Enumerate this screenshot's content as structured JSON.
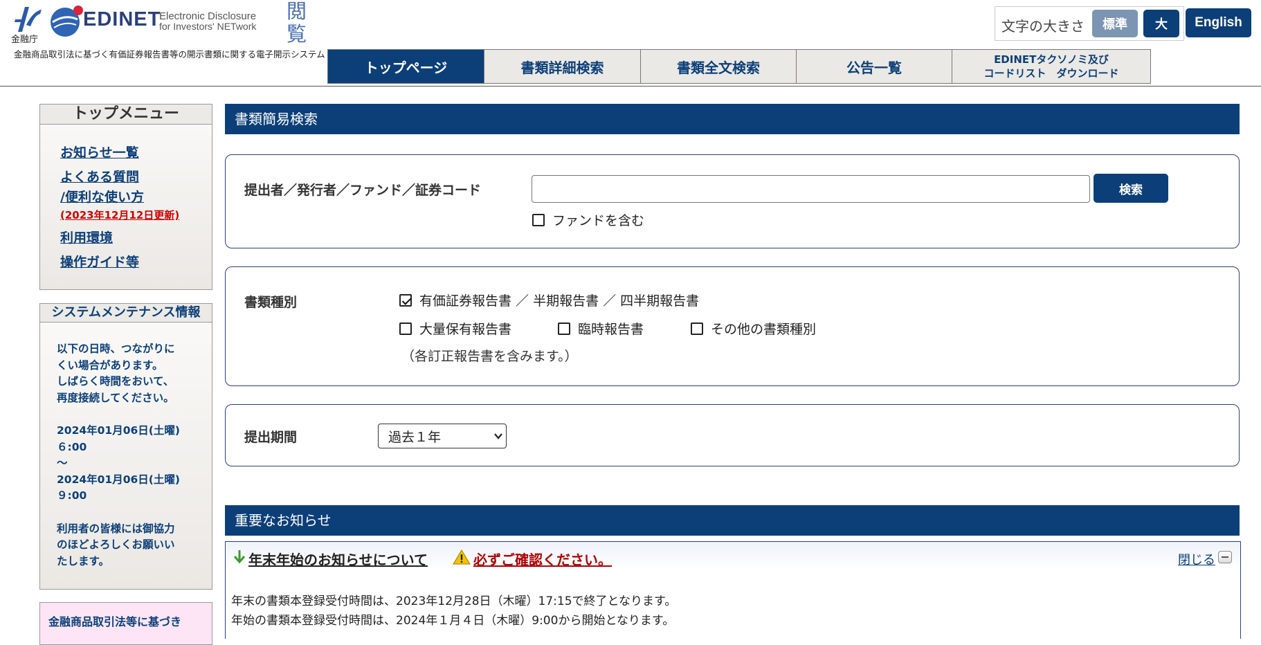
{
  "header": {
    "fsa_label": "金融庁",
    "brand": "EDINET",
    "brand_sub_1": "Electronic Disclosure",
    "brand_sub_2": "for Investors' NETwork",
    "mode_label": "閲覧",
    "system_description": "金融商品取引法に基づく有価証券報告書等の開示書類に関する電子開示システム",
    "font_size_label": "文字の大きさ",
    "font_size_standard": "標準",
    "font_size_large": "大",
    "english_label": "English"
  },
  "nav": {
    "tabs": [
      {
        "label": "トップページ"
      },
      {
        "label": "書類詳細検索"
      },
      {
        "label": "書類全文検索"
      },
      {
        "label": "公告一覧"
      },
      {
        "label_line1": "EDINETタクソノミ及び",
        "label_line2": "コードリスト　ダウンロード"
      }
    ]
  },
  "sidebar": {
    "menu_title": "トップメニュー",
    "links": [
      {
        "label": "お知らせ一覧"
      },
      {
        "label": "よくある質問"
      },
      {
        "label": "/便利な使い方"
      },
      {
        "label": "利用環境"
      },
      {
        "label": "操作ガイド等"
      }
    ],
    "faq_note": "(2023年12月12日更新)",
    "maintenance_title": "システムメンテナンス情報",
    "maintenance_lines": [
      "以下の日時、つながりに",
      "くい場合があります。",
      "しばらく時間をおいて、",
      "再度接続してください。"
    ],
    "maintenance_times": [
      "2024年01月06日(土曜)",
      "６:00",
      "～",
      "2024年01月06日(土曜)",
      "９:00"
    ],
    "maintenance_closing": [
      "利用者の皆様には御協力",
      "のほどよろしくお願いい",
      "たします。"
    ],
    "law_box_text": "金融商品取引法等に基づき"
  },
  "search": {
    "header": "書類簡易検索",
    "code_label": "提出者／発行者／ファンド／証券コード",
    "code_value": "",
    "search_button": "検索",
    "include_fund_label": "ファンドを含む",
    "include_fund_checked": false,
    "type_label": "書類種別",
    "types": [
      {
        "label": "有価証券報告書 ／ 半期報告書 ／ 四半期報告書",
        "checked": true
      },
      {
        "label": "大量保有報告書",
        "checked": false
      },
      {
        "label": "臨時報告書",
        "checked": false
      },
      {
        "label": "その他の書類種別",
        "checked": false
      }
    ],
    "type_note": "（各訂正報告書を含みます。）",
    "period_label": "提出期間",
    "period_value": "過去１年"
  },
  "notice": {
    "header": "重要なお知らせ",
    "title": "年末年始のお知らせについて",
    "warning": "必ずご確認ください。",
    "close_label": "閉じる",
    "lines": [
      "年末の書類本登録受付時間は、2023年12月28日（木曜）17:15で終了となります。",
      "年始の書類本登録受付時間は、2024年１月４日（木曜）9:00から開始となります。"
    ]
  },
  "colors": {
    "brand_navy": "#0c3f78",
    "alert_red": "#d10000",
    "warning_red": "#b00000",
    "standard_button": "#7c95b2"
  }
}
